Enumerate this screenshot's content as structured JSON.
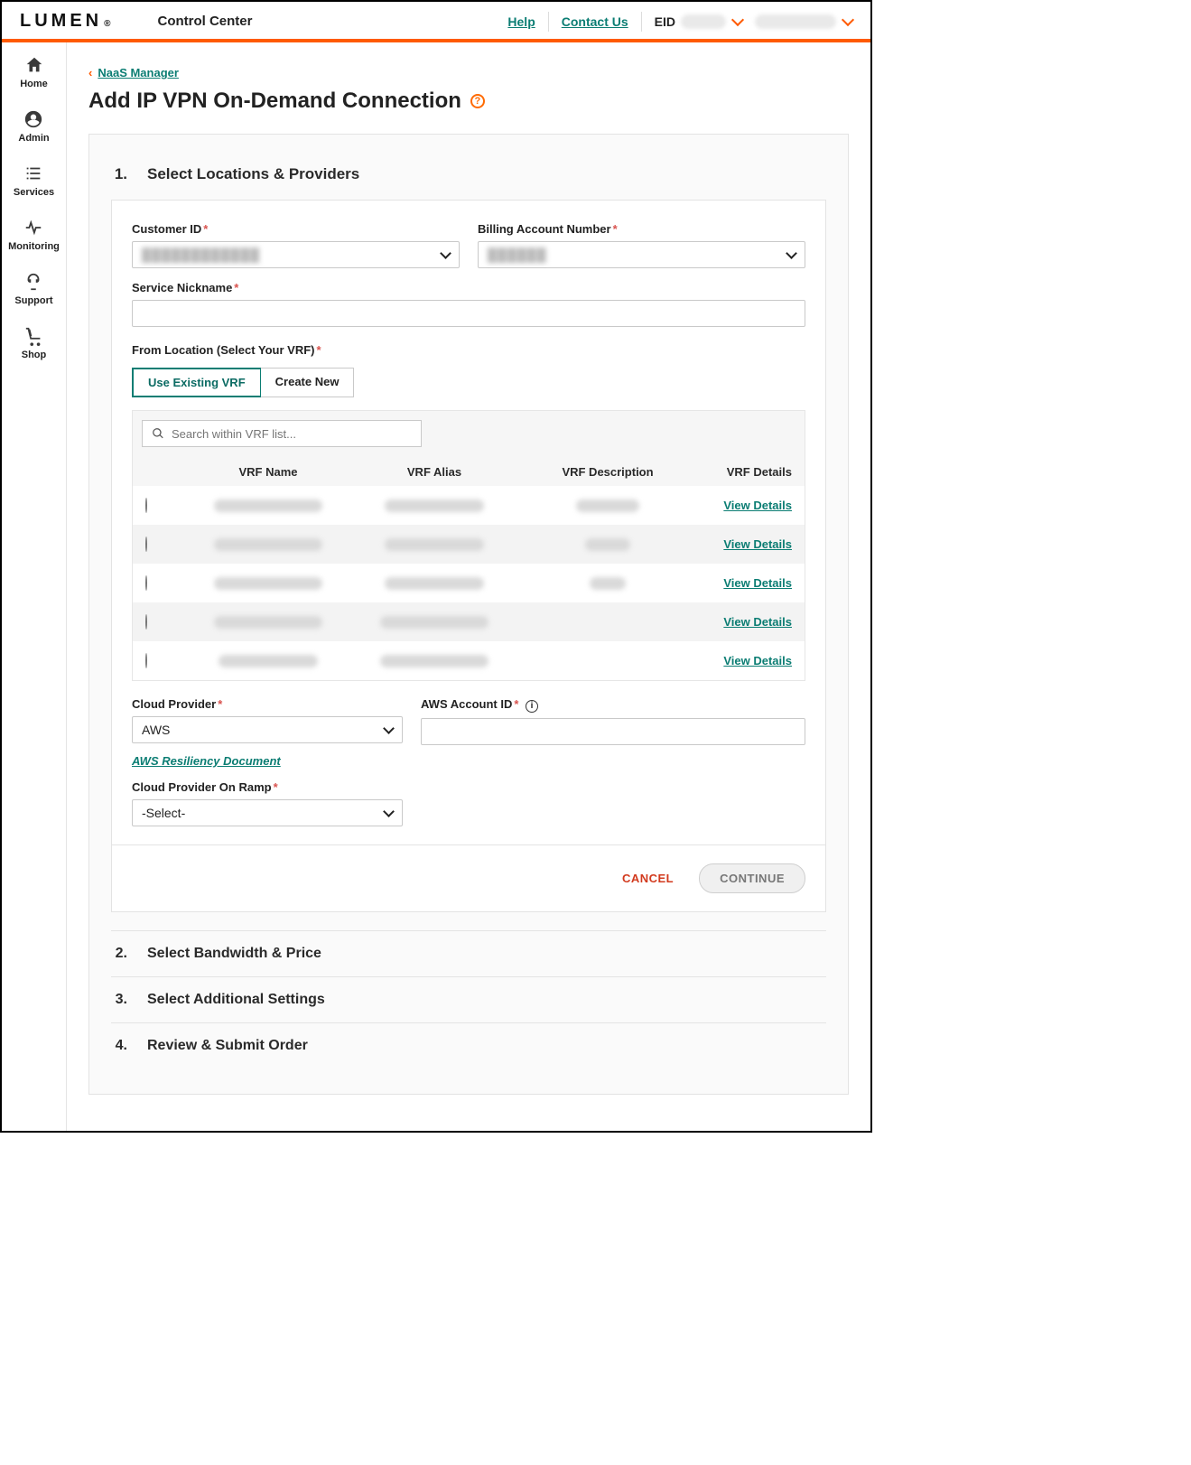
{
  "header": {
    "logo_text": "LUMEN",
    "logo_reg": "®",
    "app_title": "Control Center",
    "help": "Help",
    "contact": "Contact Us",
    "eid_label": "EID"
  },
  "sidebar": {
    "items": [
      {
        "label": "Home"
      },
      {
        "label": "Admin"
      },
      {
        "label": "Services"
      },
      {
        "label": "Monitoring"
      },
      {
        "label": "Support"
      },
      {
        "label": "Shop"
      }
    ]
  },
  "breadcrumb": {
    "back_label": "NaaS Manager"
  },
  "page": {
    "title": "Add IP VPN On-Demand Connection"
  },
  "steps": {
    "s1": {
      "num": "1.",
      "title": "Select Locations & Providers"
    },
    "s2": {
      "num": "2.",
      "title": "Select Bandwidth & Price"
    },
    "s3": {
      "num": "3.",
      "title": "Select Additional Settings"
    },
    "s4": {
      "num": "4.",
      "title": "Review & Submit Order"
    }
  },
  "form": {
    "customer_id_label": "Customer ID",
    "billing_label": "Billing Account Number",
    "nickname_label": "Service Nickname",
    "from_location_label": "From Location (Select Your VRF)",
    "tab_existing": "Use Existing VRF",
    "tab_create": "Create New",
    "search_placeholder": "Search within VRF list...",
    "vrf_headers": {
      "name": "VRF Name",
      "alias": "VRF Alias",
      "desc": "VRF Description",
      "details": "VRF Details"
    },
    "view_details": "View Details",
    "vrf_rows": [
      {
        "name": "",
        "alias": "",
        "desc": ""
      },
      {
        "name": "",
        "alias": "",
        "desc": ""
      },
      {
        "name": "",
        "alias": "",
        "desc": ""
      },
      {
        "name": "",
        "alias": "",
        "desc": ""
      },
      {
        "name": "",
        "alias": "",
        "desc": ""
      }
    ],
    "cloud_provider_label": "Cloud Provider",
    "cloud_provider_value": "AWS",
    "resiliency_link": "AWS Resiliency Document",
    "aws_account_label": "AWS Account ID",
    "on_ramp_label": "Cloud Provider On Ramp",
    "on_ramp_value": "-Select-",
    "cancel": "CANCEL",
    "continue": "CONTINUE"
  }
}
